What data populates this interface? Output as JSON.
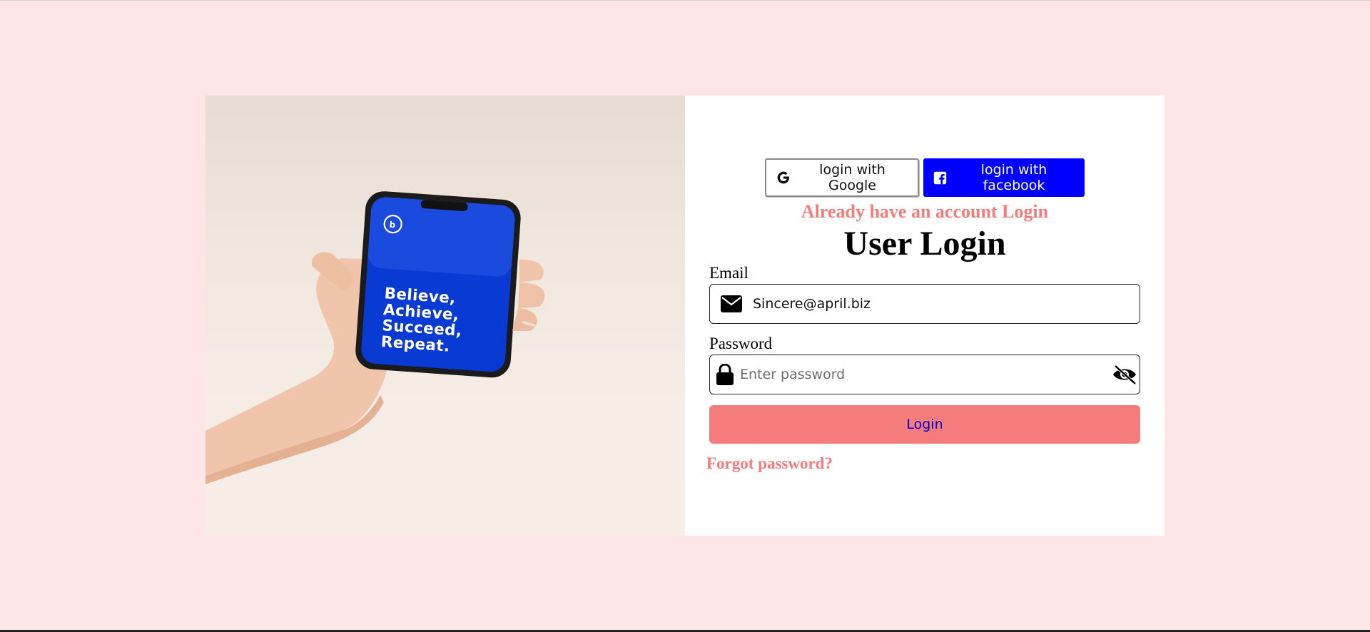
{
  "hero_image": {
    "phone_text": "Believe,\nAchieve,\nSucceed,\nRepeat."
  },
  "social": {
    "google_label": "login with Google",
    "facebook_label": "login with facebook"
  },
  "already_text": "Already have an account Login",
  "title": "User Login",
  "email": {
    "label": "Email",
    "value": "Sincere@april.biz",
    "icon": "envelope-icon"
  },
  "password": {
    "label": "Password",
    "placeholder": "Enter password",
    "icon": "lock-icon",
    "toggle_icon": "eye-slash-icon"
  },
  "login_button": "Login",
  "forgot_link": "Forgot password?",
  "colors": {
    "page_background": "#ffe5e5",
    "accent": "#f47c7c",
    "facebook_blue": "#0000ff",
    "login_text": "#0000cc"
  }
}
